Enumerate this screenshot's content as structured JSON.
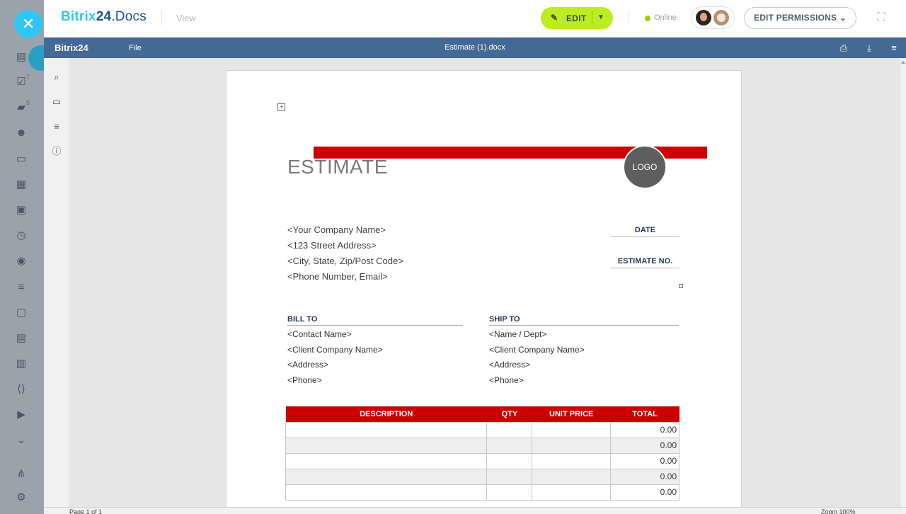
{
  "header": {
    "logo_brand": "Bitrix",
    "logo_num": "24",
    "logo_suffix": ".Docs",
    "view_label": "View",
    "edit_label": "EDIT",
    "online_label": "Online",
    "permissions_label": "EDIT PERMISSIONS"
  },
  "left_rail": {
    "badges": {
      "tasks": "7",
      "chat": "5"
    }
  },
  "editor": {
    "brand": "Bitrix24",
    "file_menu": "File",
    "document_title": "Estimate (1).docx"
  },
  "status": {
    "page_info": "Page 1 of 1",
    "zoom": "Zoom 100%"
  },
  "document": {
    "title": "ESTIMATE",
    "logo_text": "LOGO",
    "company": [
      "<Your Company Name>",
      "<123 Street Address>",
      "<City, State, Zip/Post Code>",
      "<Phone Number, Email>"
    ],
    "date_label": "DATE",
    "estimate_no_label": "ESTIMATE NO.",
    "bill_to": {
      "heading": "BILL TO",
      "lines": [
        "<Contact Name>",
        "<Client Company Name>",
        "<Address>",
        "<Phone>"
      ]
    },
    "ship_to": {
      "heading": "SHIP TO",
      "lines": [
        "<Name / Dept>",
        "<Client Company Name>",
        "<Address>",
        "<Phone>"
      ]
    },
    "table": {
      "headers": [
        "DESCRIPTION",
        "QTY",
        "UNIT PRICE",
        "TOTAL"
      ],
      "rows": [
        [
          "",
          "",
          "",
          "0.00"
        ],
        [
          "",
          "",
          "",
          "0.00"
        ],
        [
          "",
          "",
          "",
          "0.00"
        ],
        [
          "",
          "",
          "",
          "0.00"
        ],
        [
          "",
          "",
          "",
          "0.00"
        ]
      ]
    }
  },
  "colors": {
    "accent_red": "#cc0000",
    "edit_green": "#bbed21",
    "editor_header": "#446995",
    "bitrix_blue": "#2fc6f6"
  }
}
